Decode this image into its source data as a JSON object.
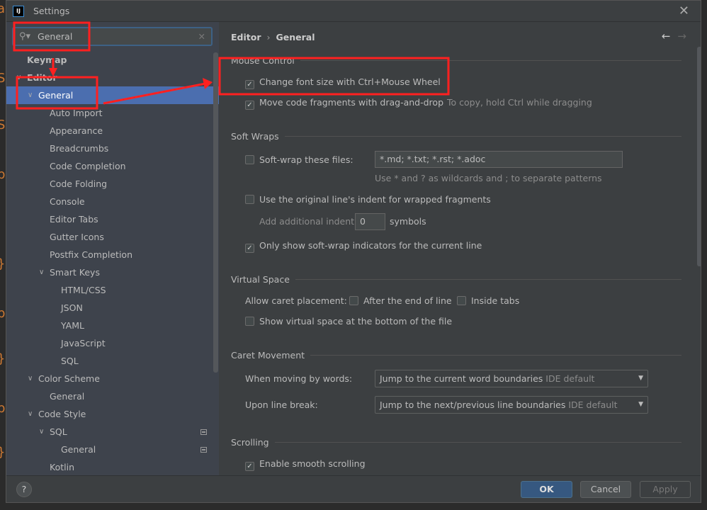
{
  "window": {
    "title": "Settings",
    "logo": "IJ"
  },
  "search": {
    "value": "General"
  },
  "tree": [
    {
      "label": "Keymap",
      "level": 0,
      "bold": true
    },
    {
      "label": "Editor",
      "level": 0,
      "bold": true,
      "expanded": true
    },
    {
      "label": "General",
      "level": 1,
      "expanded": true,
      "selected": true
    },
    {
      "label": "Auto Import",
      "level": 2
    },
    {
      "label": "Appearance",
      "level": 2
    },
    {
      "label": "Breadcrumbs",
      "level": 2
    },
    {
      "label": "Code Completion",
      "level": 2
    },
    {
      "label": "Code Folding",
      "level": 2
    },
    {
      "label": "Console",
      "level": 2
    },
    {
      "label": "Editor Tabs",
      "level": 2
    },
    {
      "label": "Gutter Icons",
      "level": 2
    },
    {
      "label": "Postfix Completion",
      "level": 2
    },
    {
      "label": "Smart Keys",
      "level": 2,
      "expanded": true
    },
    {
      "label": "HTML/CSS",
      "level": 3
    },
    {
      "label": "JSON",
      "level": 3
    },
    {
      "label": "YAML",
      "level": 3
    },
    {
      "label": "JavaScript",
      "level": 3
    },
    {
      "label": "SQL",
      "level": 3
    },
    {
      "label": "Color Scheme",
      "level": 1,
      "expanded": true
    },
    {
      "label": "General",
      "level": 2
    },
    {
      "label": "Code Style",
      "level": 1,
      "expanded": true
    },
    {
      "label": "SQL",
      "level": 2,
      "expanded": true,
      "project_icon": true
    },
    {
      "label": "General",
      "level": 3,
      "project_icon": true
    },
    {
      "label": "Kotlin",
      "level": 2
    }
  ],
  "breadcrumb": {
    "parent": "Editor",
    "current": "General"
  },
  "content": {
    "mouse_control": {
      "title": "Mouse Control",
      "change_font": {
        "label": "Change font size with Ctrl+Mouse Wheel",
        "checked": true
      },
      "move_code": {
        "label": "Move code fragments with drag-and-drop",
        "checked": true,
        "hint": "To copy, hold Ctrl while dragging"
      }
    },
    "soft_wraps": {
      "title": "Soft Wraps",
      "soft_wrap": {
        "label": "Soft-wrap these files:",
        "checked": false,
        "value": "*.md; *.txt; *.rst; *.adoc",
        "hint": "Use * and ? as wildcards and ; to separate patterns"
      },
      "original_indent": {
        "label": "Use the original line's indent for wrapped fragments",
        "checked": false
      },
      "additional_indent": {
        "label": "Add additional indent:",
        "value": "0",
        "unit": "symbols"
      },
      "only_current": {
        "label": "Only show soft-wrap indicators for the current line",
        "checked": true
      }
    },
    "virtual_space": {
      "title": "Virtual Space",
      "caret_label": "Allow caret placement:",
      "after_end": {
        "label": "After the end of line",
        "checked": false
      },
      "inside_tabs": {
        "label": "Inside tabs",
        "checked": false
      },
      "show_bottom": {
        "label": "Show virtual space at the bottom of the file",
        "checked": false
      }
    },
    "caret_movement": {
      "title": "Caret Movement",
      "words_label": "When moving by words:",
      "words_value": "Jump to the current word boundaries",
      "words_default": "IDE default",
      "break_label": "Upon line break:",
      "break_value": "Jump to the next/previous line boundaries",
      "break_default": "IDE default"
    },
    "scrolling": {
      "title": "Scrolling",
      "smooth": {
        "label": "Enable smooth scrolling",
        "checked": true
      }
    }
  },
  "footer": {
    "help": "?",
    "ok": "OK",
    "cancel": "Cancel",
    "apply": "Apply"
  },
  "colors": {
    "selection": "#4b6eaf",
    "annotation": "#ff2020",
    "ok": "#365880"
  }
}
